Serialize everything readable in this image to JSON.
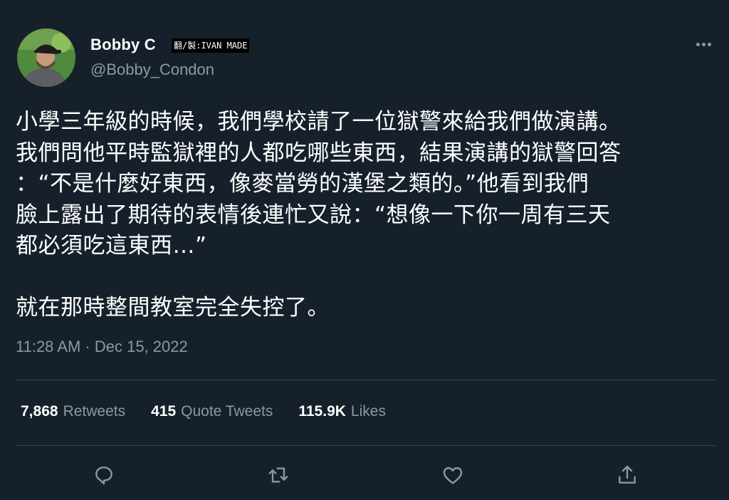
{
  "author": {
    "display_name": "Bobby C",
    "handle": "@Bobby_Condon",
    "credit_label": "翻/製:IVAN MADE"
  },
  "tweet": {
    "text": "小學三年級的時候，我們學校請了一位獄警來給我們做演講。\n我們問他平時監獄裡的人都吃哪些東西，結果演講的獄警回答\n：“不是什麼好東西，像麥當勞的漢堡之類的。”他看到我們\n臉上露出了期待的表情後連忙又說：“想像一下你一周有三天\n都必須吃這東西…”\n\n就在那時整間教室完全失控了。",
    "timestamp": "11:28 AM · Dec 15, 2022"
  },
  "stats": {
    "retweets_count": "7,868",
    "retweets_label": "Retweets",
    "quotes_count": "415",
    "quotes_label": "Quote Tweets",
    "likes_count": "115.9K",
    "likes_label": "Likes"
  },
  "icons": {
    "more": "more-horizontal-icon",
    "reply": "reply-icon",
    "retweet": "retweet-icon",
    "like": "heart-icon",
    "share": "share-icon"
  },
  "colors": {
    "background": "#15202b",
    "secondary_text": "#8b98a5",
    "divider": "#38444d"
  }
}
